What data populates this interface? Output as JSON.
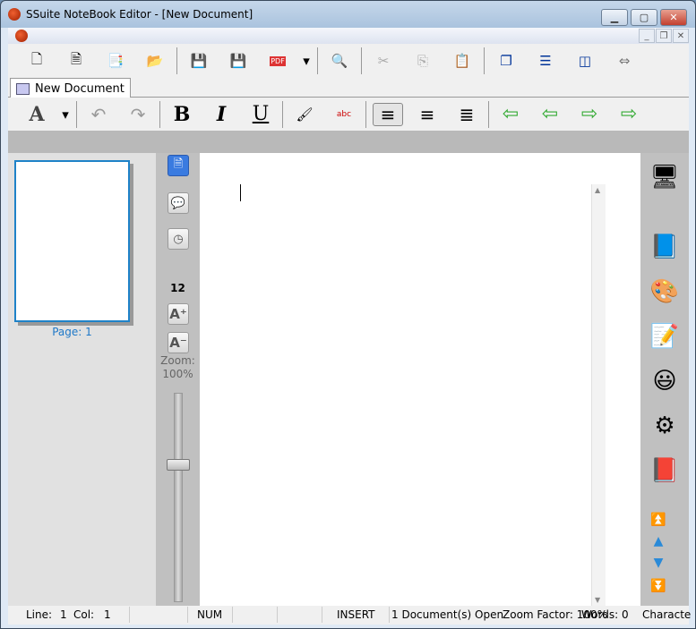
{
  "window": {
    "title": "SSuite NoteBook Editor - [New Document]"
  },
  "toolbar1": [
    {
      "name": "new-document",
      "glyph": "🗋"
    },
    {
      "name": "new-from-template",
      "glyph": "🗎"
    },
    {
      "name": "copy-document",
      "glyph": "📑"
    },
    {
      "name": "open",
      "glyph": "📂"
    },
    {
      "name": "save",
      "glyph": "💾"
    },
    {
      "name": "save-as",
      "glyph": "💾"
    },
    {
      "name": "export-pdf",
      "glyph": "PDF"
    },
    {
      "name": "pdf-dropdown",
      "glyph": "▾"
    },
    {
      "name": "print-preview",
      "glyph": "🔍"
    },
    {
      "name": "cut",
      "glyph": "✂"
    },
    {
      "name": "copy",
      "glyph": "⎘"
    },
    {
      "name": "paste",
      "glyph": "📋"
    },
    {
      "name": "cascade",
      "glyph": "❐"
    },
    {
      "name": "tile-horizontal",
      "glyph": "☰"
    },
    {
      "name": "tile-vertical",
      "glyph": "◫"
    },
    {
      "name": "arrange",
      "glyph": "⇔"
    }
  ],
  "tab": {
    "label": "New Document"
  },
  "toolbar2": [
    {
      "name": "font",
      "glyph": "A"
    },
    {
      "name": "font-dropdown",
      "glyph": "▾"
    },
    {
      "name": "undo",
      "glyph": "↶"
    },
    {
      "name": "redo",
      "glyph": "↷"
    },
    {
      "name": "bold",
      "glyph": "B"
    },
    {
      "name": "italic",
      "glyph": "I"
    },
    {
      "name": "underline",
      "glyph": "U"
    },
    {
      "name": "highlight",
      "glyph": "🖌"
    },
    {
      "name": "spellcheck",
      "glyph": "abc"
    },
    {
      "name": "align-left",
      "glyph": "≡"
    },
    {
      "name": "align-center",
      "glyph": "≡"
    },
    {
      "name": "justify",
      "glyph": "≣"
    },
    {
      "name": "outdent",
      "glyph": "⇦"
    },
    {
      "name": "decrease-indent",
      "glyph": "⇦"
    },
    {
      "name": "increase-indent",
      "glyph": "⇨"
    },
    {
      "name": "indent",
      "glyph": "⇨"
    }
  ],
  "pages": {
    "label": "Page: 1"
  },
  "side": {
    "font_size": "12",
    "zoom_label": "Zoom:",
    "zoom_value": "100%",
    "zoom_percent": 100
  },
  "status": {
    "line_label": "Line:",
    "line": "1",
    "col_label": "Col:",
    "col": "1",
    "num": "NUM",
    "insert": "INSERT",
    "docs": "1 Document(s) Open",
    "zoom": "Zoom Factor: 100%",
    "words": "Words:  0",
    "chars": "Characte"
  },
  "colors": {
    "accent": "#1e82c8",
    "panel": "#c0c0c0"
  }
}
